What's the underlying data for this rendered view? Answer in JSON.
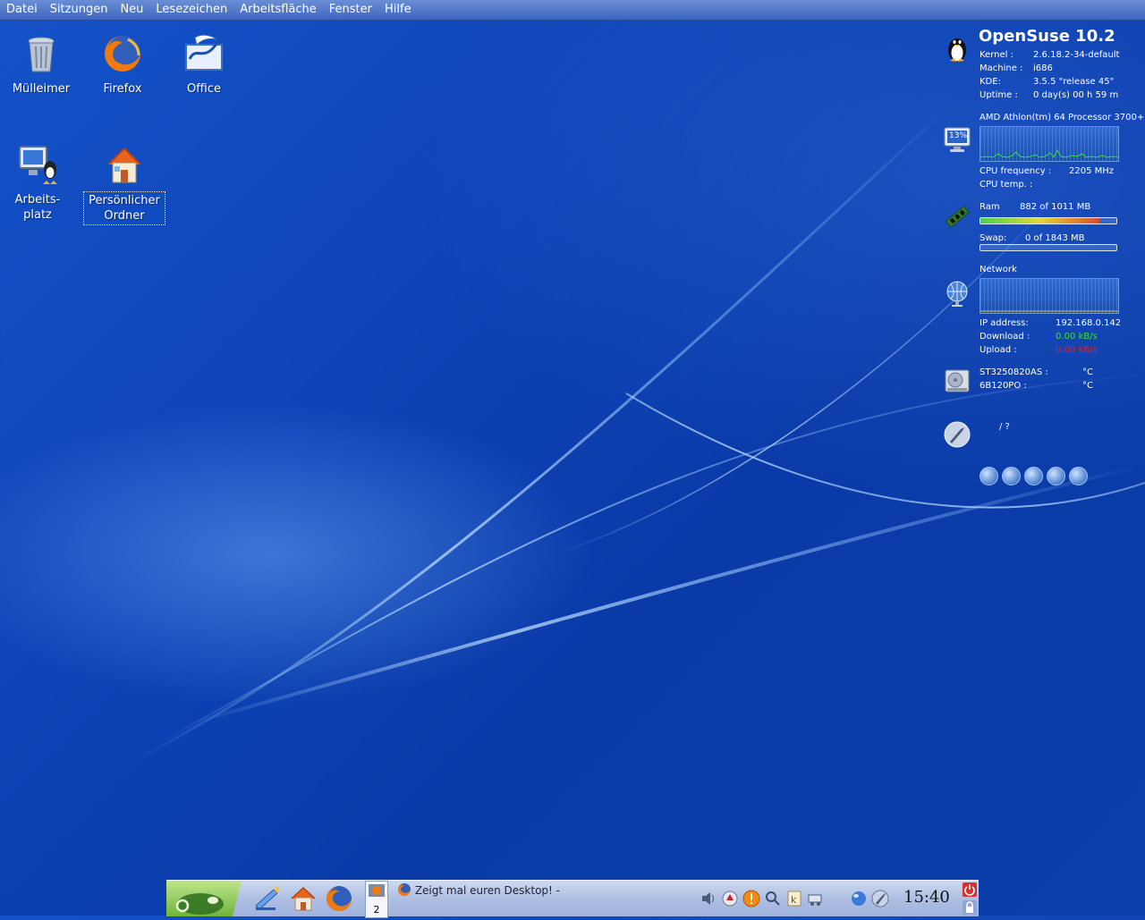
{
  "menubar": {
    "items": [
      "Datei",
      "Sitzungen",
      "Neu",
      "Lesezeichen",
      "Arbeitsfläche",
      "Fenster",
      "Hilfe"
    ]
  },
  "desktop": {
    "icons": [
      {
        "label": "Mülleimer",
        "icon": "trash-icon"
      },
      {
        "label": "Firefox",
        "icon": "firefox-icon"
      },
      {
        "label": "Office",
        "icon": "office-icon"
      },
      {
        "label": "Arbeits-\nplatz",
        "icon": "computer-icon"
      },
      {
        "label": "Persönlicher\nOrdner",
        "icon": "home-folder-icon"
      }
    ]
  },
  "widget": {
    "title": "OpenSuse 10.2",
    "system": {
      "kernel_label": "Kernel :",
      "kernel": "2.6.18.2-34-default",
      "machine_label": "Machine :",
      "machine": "i686",
      "kde_label": "KDE:",
      "kde": "3.5.5 \"release 45\"",
      "uptime_label": "Uptime :",
      "uptime": "0 day(s)  00 h 59 m"
    },
    "cpu": {
      "name": "AMD Athlon(tm) 64 Processor 3700+",
      "load_badge": "13%",
      "freq_label": "CPU frequency :",
      "freq": "2205 MHz",
      "temp_label": "CPU temp. :"
    },
    "memory": {
      "ram_label": "Ram",
      "ram": "882 of 1011 MB",
      "ram_fraction": 0.872,
      "swap_label": "Swap:",
      "swap": "0 of 1843 MB",
      "swap_fraction": 0.0
    },
    "network": {
      "title": "Network",
      "ip_label": "IP address:",
      "ip": "192.168.0.142",
      "download_label": "Download :",
      "download": "0.00 kB/s",
      "upload_label": "Upload :",
      "upload": "0.00 kB/s",
      "download_color": "#35e035",
      "upload_color": "#e02020"
    },
    "disks": {
      "d1_label": "ST3250820AS :",
      "d1_unit": "°C",
      "d2_label": "6B120PO :",
      "d2_unit": "°C"
    },
    "player": {
      "track": "/ ?"
    }
  },
  "taskbar": {
    "pager_number": "2",
    "task_title": "Zeigt mal euren Desktop! -",
    "clock": "15:40"
  },
  "colors": {
    "menubar": "#4a72c6",
    "taskbar": "#b3c3e6",
    "wallpaper": "#0e44b8"
  }
}
